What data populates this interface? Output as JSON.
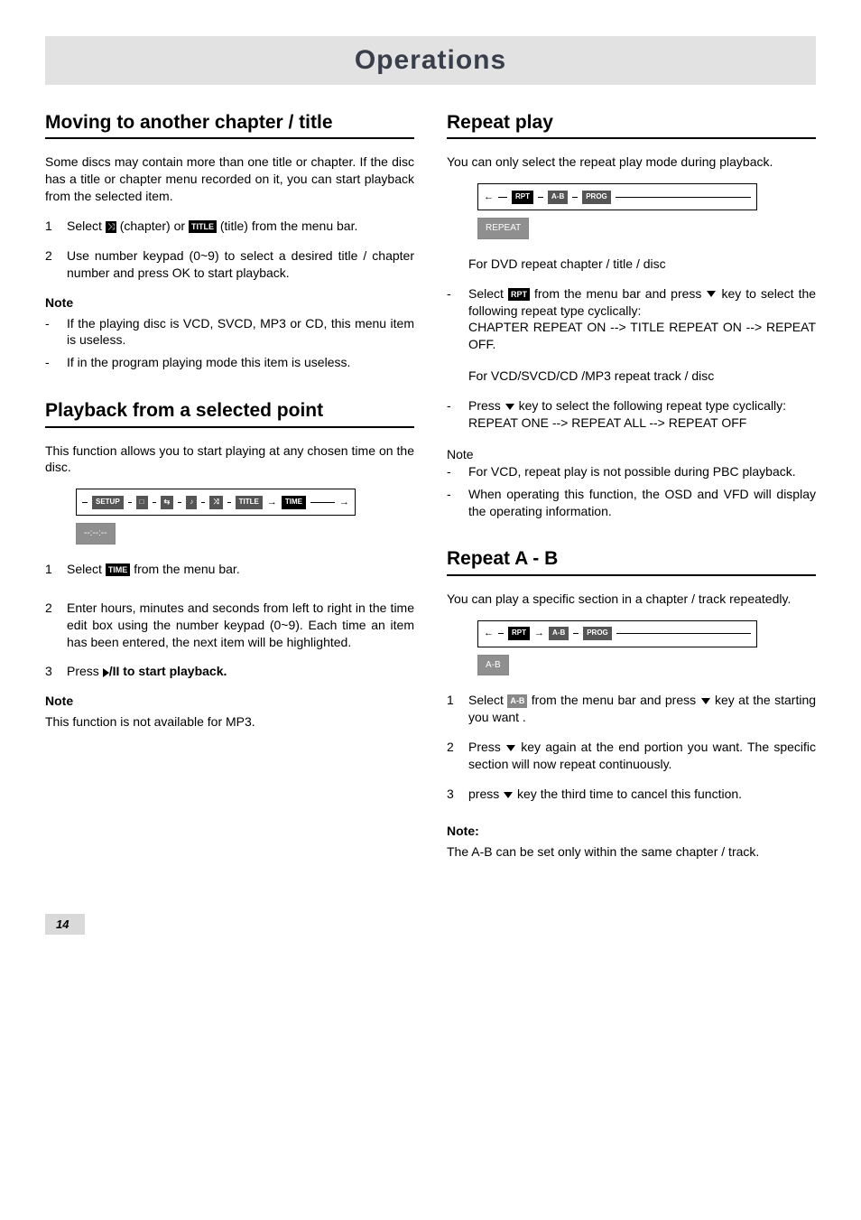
{
  "page_title": "Operations",
  "page_number": "14",
  "left": {
    "s1": {
      "title": "Moving to another chapter / title",
      "intro": "Some discs may contain more than one title or chapter. If the disc has a title or chapter menu recorded on it, you can start playback from the selected item.",
      "step1_a": "Select",
      "step1_b": "(chapter) or",
      "step1_c": "(title)  from the menu bar.",
      "icon_title": "TITLE",
      "step2": "Use number keypad (0~9) to select a desired title / chapter number and press OK to start playback.",
      "note_label": "Note",
      "note1": "If the playing disc is VCD, SVCD, MP3 or CD, this menu item is useless.",
      "note2": "If in the program playing mode this item is useless."
    },
    "s2": {
      "title": "Playback from a selected point",
      "intro": "This function allows you to start playing at any chosen time on the disc.",
      "osd_chips": [
        "SETUP",
        "□",
        "⇆",
        "♪",
        "⤨",
        "TITLE",
        "TIME"
      ],
      "osd_label": "--:--:--",
      "step1_a": "Select",
      "step1_b": "from the menu bar.",
      "icon_time": "TIME",
      "step2": "Enter hours, minutes and seconds from left to right in the time edit box using the number keypad (0~9). Each time an item has been entered, the next item will be highlighted.",
      "step3_a": "Press ",
      "step3_b": "/II to start playback.",
      "note_label": "Note",
      "note1": "This function is not available for MP3."
    }
  },
  "right": {
    "s1": {
      "title": "Repeat play",
      "intro": "You can only select the repeat play mode  during playback.",
      "osd_chips": [
        "RPT",
        "A-B",
        "PROG"
      ],
      "osd_label": "REPEAT",
      "sub_dvd": "For DVD repeat chapter / title / disc",
      "b1_a": "Select",
      "b1_b": "from the menu bar and press",
      "b1_c": "key to select the following repeat type cyclically:",
      "icon_rpt": "RPT",
      "b1_d": "CHAPTER REPEAT ON --> TITLE REPEAT ON --> REPEAT OFF.",
      "sub_vcd": "For VCD/SVCD/CD /MP3 repeat track / disc",
      "b2_a": "Press",
      "b2_b": "key to select the following repeat type cyclically:",
      "b2_c": "REPEAT ONE -->  REPEAT ALL --> REPEAT OFF",
      "note_label": "Note",
      "note1": "For VCD, repeat play is not possible during PBC playback.",
      "note2": "When operating this function, the OSD and VFD will display the operating information."
    },
    "s2": {
      "title": "Repeat A - B",
      "intro": "You can play a specific section in a chapter / track repeatedly.",
      "osd_chips": [
        "RPT",
        "A-B",
        "PROG"
      ],
      "osd_label": "A-B",
      "st1_a": "Select",
      "st1_b": "from the menu bar and press",
      "st1_c": "key  at the starting you want .",
      "icon_ab": "A-B",
      "st2_a": "Press",
      "st2_b": "key again at the end portion you want. The specific section will now repeat continuously.",
      "st3_a": "press",
      "st3_b": "key the third time to cancel this function.",
      "note_label": "Note:",
      "note1": "The A-B can be set only within the same chapter / track."
    }
  }
}
